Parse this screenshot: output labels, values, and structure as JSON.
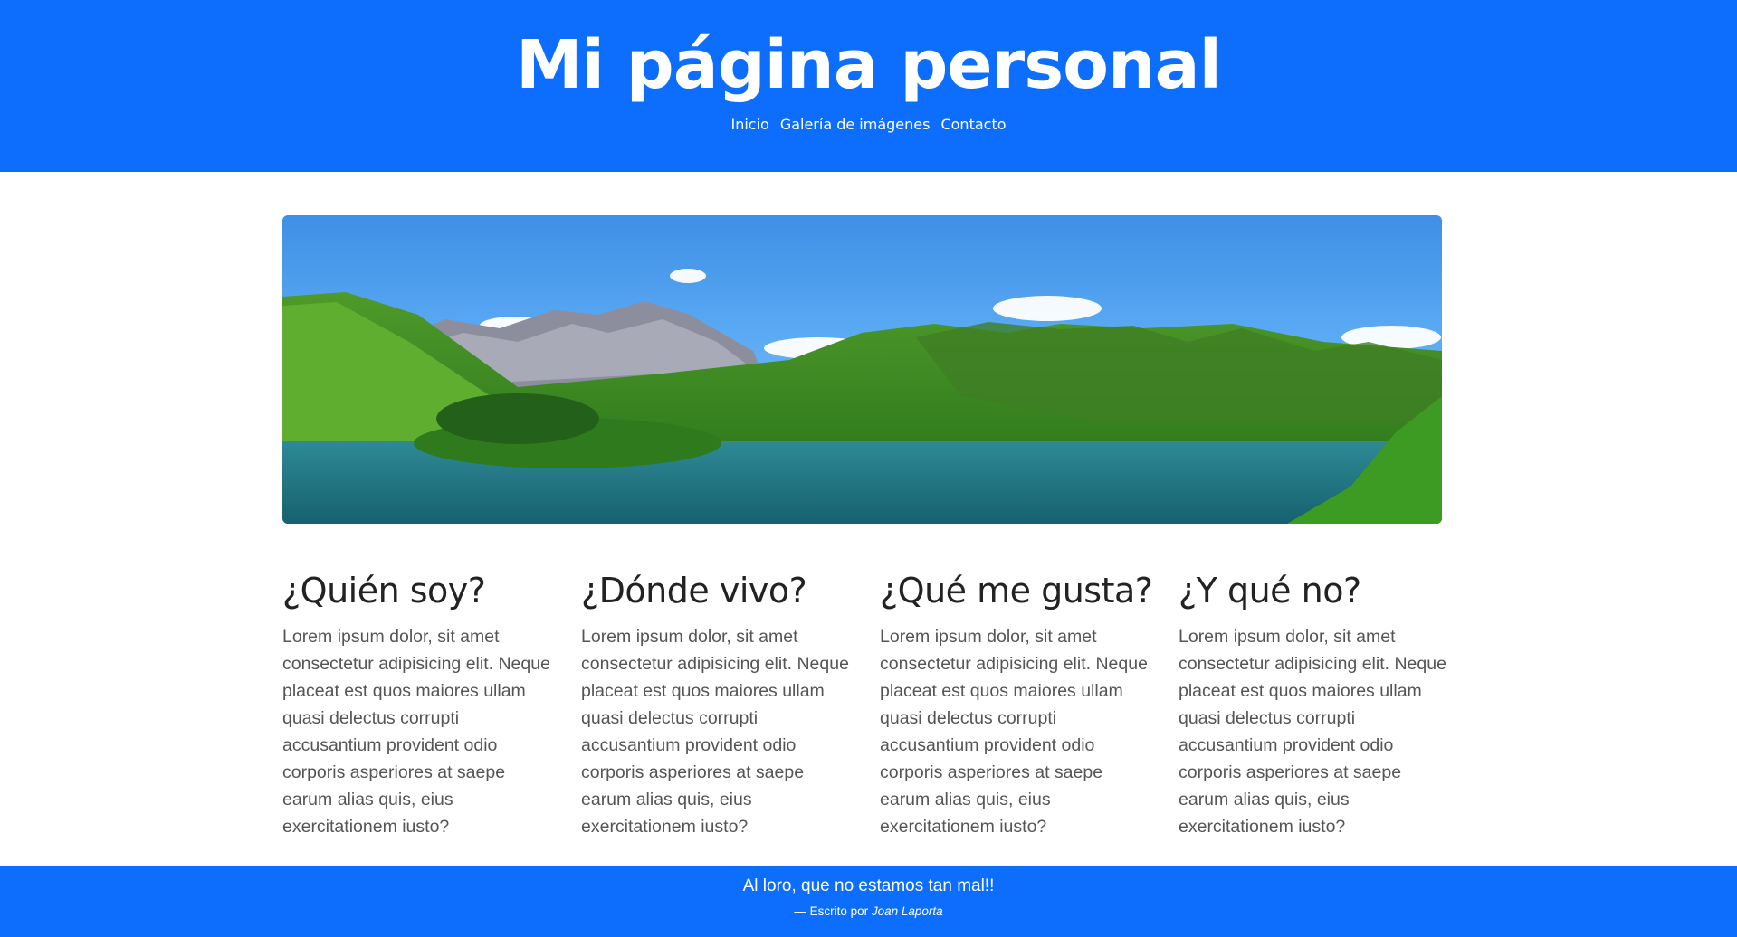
{
  "header": {
    "title": "Mi página personal",
    "nav": [
      "Inicio",
      "Galería de imágenes",
      "Contacto"
    ]
  },
  "hero": {
    "image": "mountain-lake-landscape"
  },
  "sections": [
    {
      "heading": "¿Quién soy?",
      "body": "Lorem ipsum dolor, sit amet consectetur adipisicing elit. Neque placeat est quos maiores ullam quasi delectus corrupti accusantium provident odio corporis asperiores at saepe earum alias quis, eius exercitationem iusto?"
    },
    {
      "heading": "¿Dónde vivo?",
      "body": "Lorem ipsum dolor, sit amet consectetur adipisicing elit. Neque placeat est quos maiores ullam quasi delectus corrupti accusantium provident odio corporis asperiores at saepe earum alias quis, eius exercitationem iusto?"
    },
    {
      "heading": "¿Qué me gusta?",
      "body": "Lorem ipsum dolor, sit amet consectetur adipisicing elit. Neque placeat est quos maiores ullam quasi delectus corrupti accusantium provident odio corporis asperiores at saepe earum alias quis, eius exercitationem iusto?"
    },
    {
      "heading": "¿Y qué no?",
      "body": "Lorem ipsum dolor, sit amet consectetur adipisicing elit. Neque placeat est quos maiores ullam quasi delectus corrupti accusantium provident odio corporis asperiores at saepe earum alias quis, eius exercitationem iusto?"
    }
  ],
  "footer": {
    "quote": "Al loro, que no estamos tan mal!!",
    "cite_prefix": "— Escrito por ",
    "cite_author": "Joan Laporta"
  },
  "colors": {
    "brand": "#0d6efd"
  }
}
